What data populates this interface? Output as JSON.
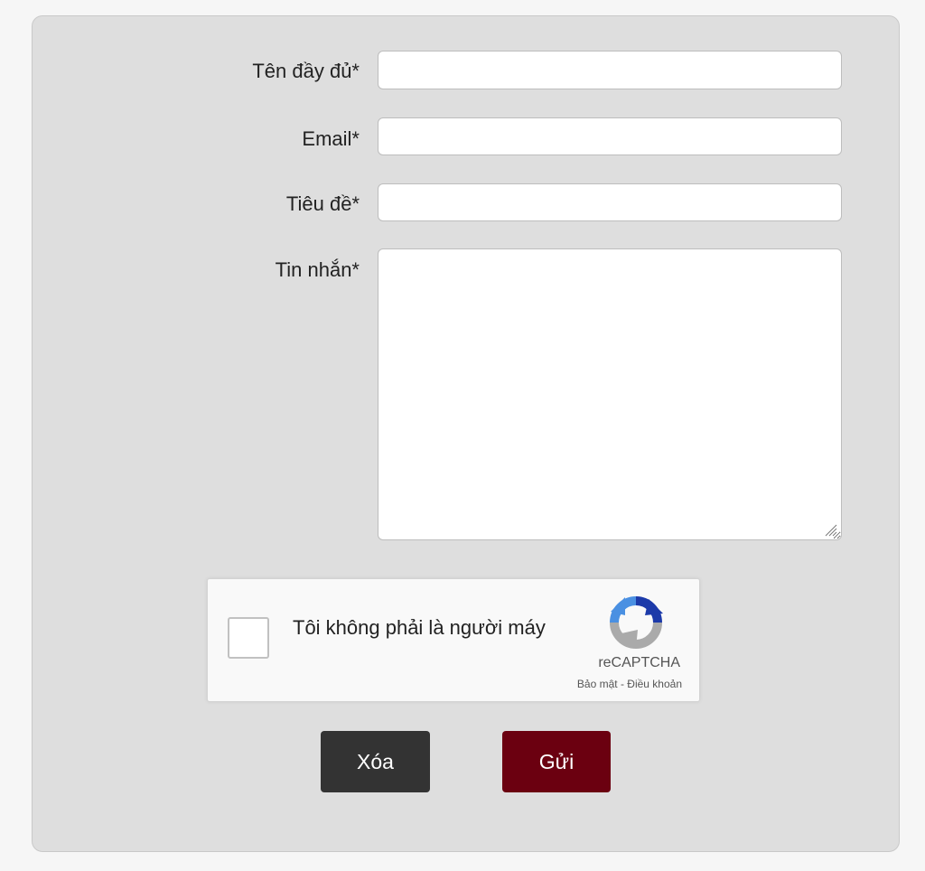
{
  "form": {
    "fullname": {
      "label": "Tên đầy đủ*",
      "value": ""
    },
    "email": {
      "label": "Email*",
      "value": ""
    },
    "subject": {
      "label": "Tiêu đề*",
      "value": ""
    },
    "message": {
      "label": "Tin nhắn*",
      "value": ""
    }
  },
  "captcha": {
    "text": "Tôi không phải là người máy",
    "brand": "reCAPTCHA",
    "privacy": "Bảo mật",
    "separator": " - ",
    "terms": "Điều khoản"
  },
  "buttons": {
    "clear": "Xóa",
    "send": "Gửi"
  },
  "colors": {
    "send_button": "#6b0010",
    "clear_button": "#333333",
    "panel_bg": "#dedede"
  }
}
